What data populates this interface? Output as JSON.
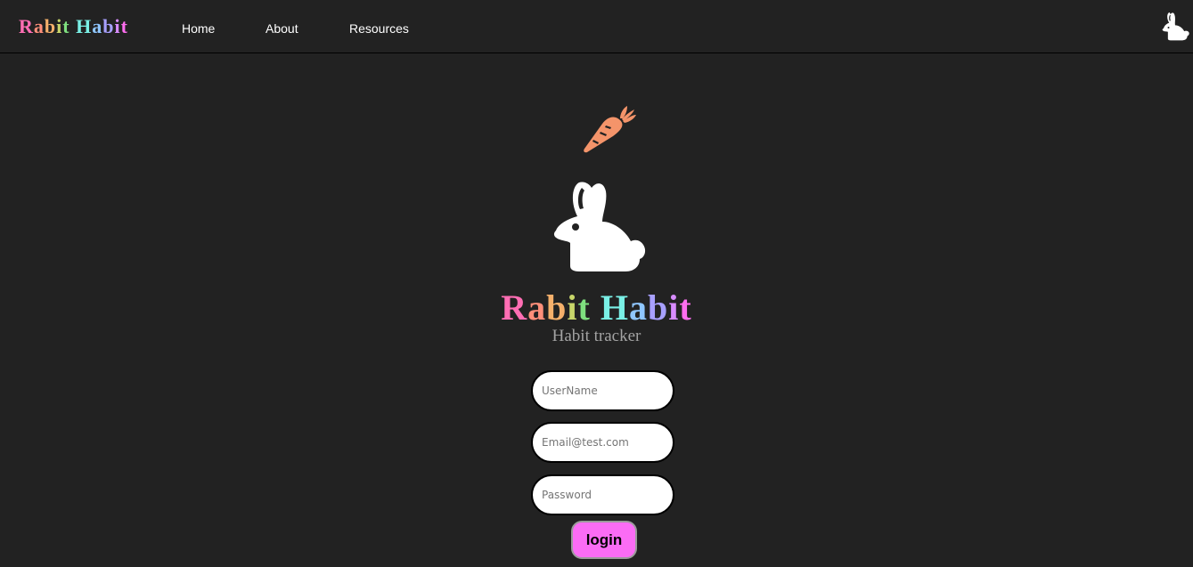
{
  "navbar": {
    "brand": [
      "R",
      "a",
      "b",
      "i",
      "t",
      " ",
      "H",
      "a",
      "b",
      "i",
      "t"
    ],
    "links": {
      "home": "Home",
      "about": "About",
      "resources": "Resources"
    },
    "profile_icon": "rabbit-icon"
  },
  "hero": {
    "carrot_icon": "carrot-icon",
    "rabbit_icon": "rabbit-icon",
    "title": [
      "R",
      "a",
      "b",
      "i",
      "t",
      " ",
      "H",
      "a",
      "b",
      "i",
      "t"
    ],
    "subtitle": "Habit tracker"
  },
  "form": {
    "username_placeholder": "UserName",
    "email_placeholder": "Email@test.com",
    "password_placeholder": "Password",
    "login_label": "login"
  },
  "colors": {
    "background": "#222222",
    "login_button": "#fb6cf5",
    "carrot": "#f4946a",
    "rainbow": [
      "#ff6eb4",
      "#ff8f7a",
      "#f5b06b",
      "#c8d66a",
      "#7fe07f",
      "#ffffff",
      "#7af0e6",
      "#8fc6ff",
      "#a8a0ff",
      "#d88cff",
      "#ff6ef0"
    ]
  }
}
